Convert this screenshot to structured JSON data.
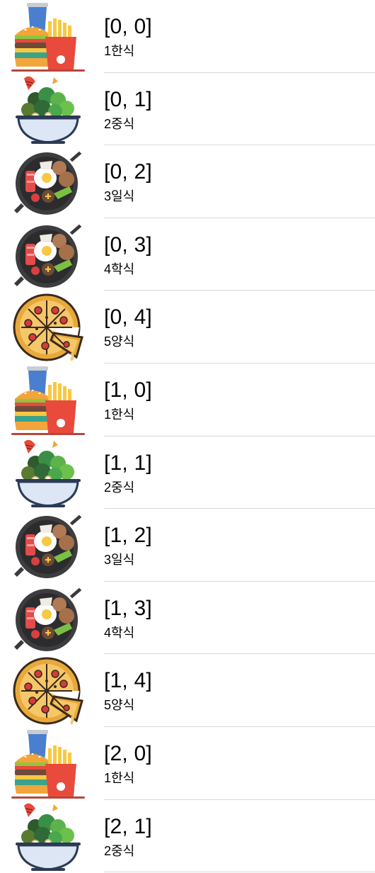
{
  "rows": [
    {
      "title": "[0, 0]",
      "subtitle": "1한식",
      "icon": "burger-fries-drink-icon"
    },
    {
      "title": "[0, 1]",
      "subtitle": "2중식",
      "icon": "salad-bowl-icon"
    },
    {
      "title": "[0, 2]",
      "subtitle": "3일식",
      "icon": "frying-pan-breakfast-icon"
    },
    {
      "title": "[0, 3]",
      "subtitle": "4학식",
      "icon": "frying-pan-breakfast-icon"
    },
    {
      "title": "[0, 4]",
      "subtitle": "5양식",
      "icon": "pizza-icon"
    },
    {
      "title": "[1, 0]",
      "subtitle": "1한식",
      "icon": "burger-fries-drink-icon"
    },
    {
      "title": "[1, 1]",
      "subtitle": "2중식",
      "icon": "salad-bowl-icon"
    },
    {
      "title": "[1, 2]",
      "subtitle": "3일식",
      "icon": "frying-pan-breakfast-icon"
    },
    {
      "title": "[1, 3]",
      "subtitle": "4학식",
      "icon": "frying-pan-breakfast-icon"
    },
    {
      "title": "[1, 4]",
      "subtitle": "5양식",
      "icon": "pizza-icon"
    },
    {
      "title": "[2, 0]",
      "subtitle": "1한식",
      "icon": "burger-fries-drink-icon"
    },
    {
      "title": "[2, 1]",
      "subtitle": "2중식",
      "icon": "salad-bowl-icon"
    }
  ]
}
